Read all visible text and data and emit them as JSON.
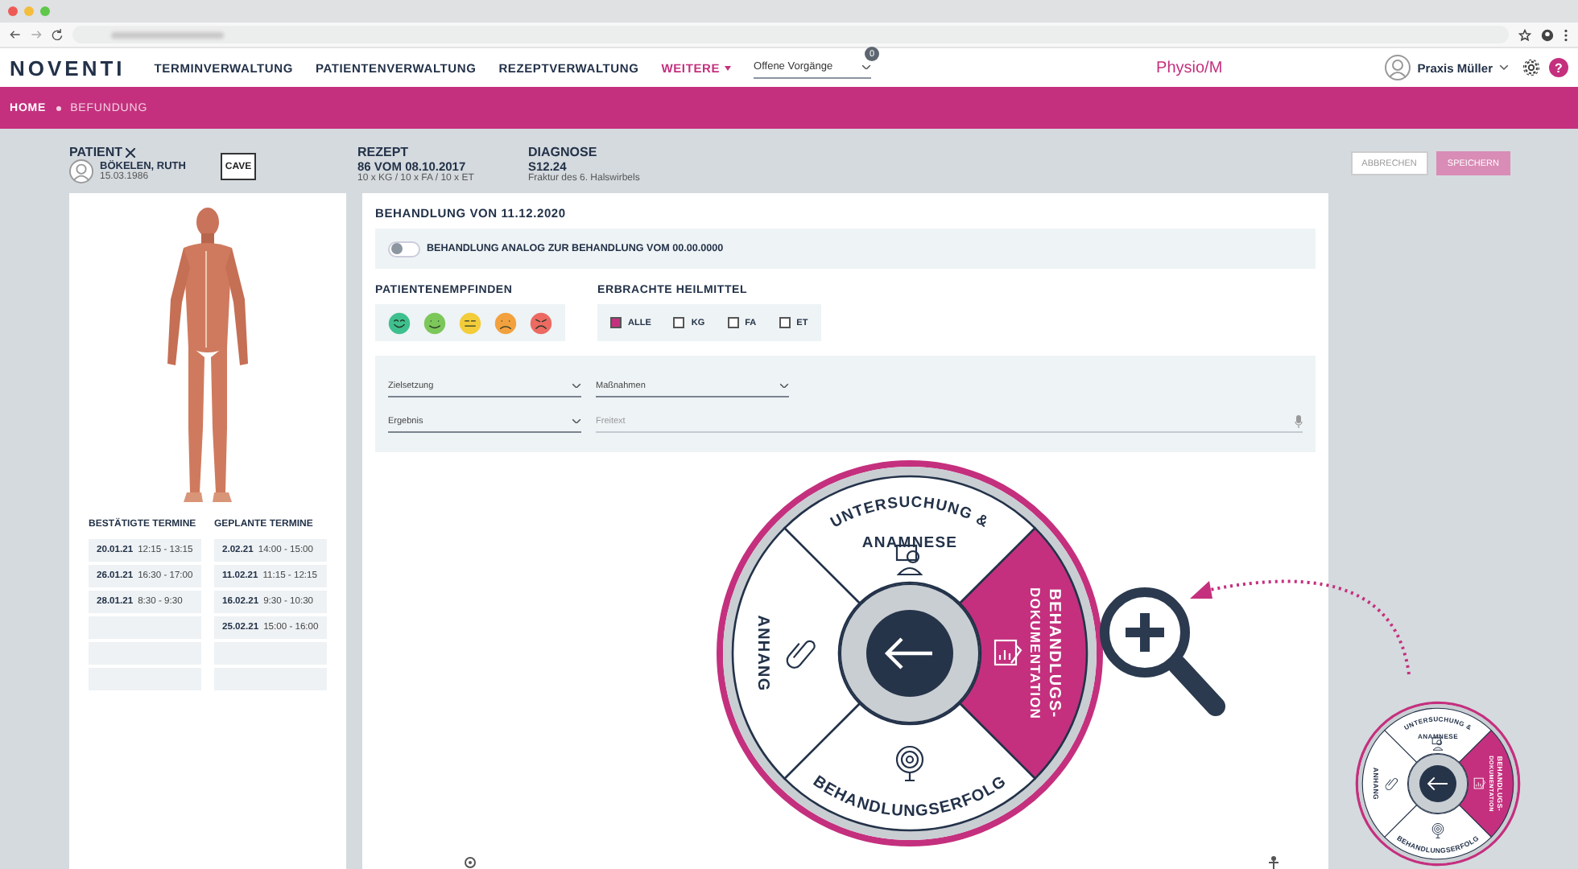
{
  "nav": {
    "logo": "NOVENTI",
    "items": [
      {
        "label": "TERMINVERWALTUNG",
        "selected": false
      },
      {
        "label": "PATIENTENVERWALTUNG",
        "selected": false
      },
      {
        "label": "REZEPTVERWALTUNG",
        "selected": false
      },
      {
        "label": "WEITERE",
        "selected": true
      }
    ],
    "dropdown": {
      "value": "Offene Vorgänge",
      "badge": "0"
    },
    "module": "Physio/M",
    "user": "Praxis Müller",
    "help": "?"
  },
  "breadcrumb": [
    "HOME",
    "BEFUNDUNG"
  ],
  "patient": {
    "heading": "PATIENT",
    "name": "BÖKELEN, RUTH",
    "birthdate": "15.03.1986",
    "cave": "CAVE"
  },
  "rezept": {
    "heading": "REZEPT",
    "title": "86 VOM 08.10.2017",
    "detail": "10 x KG / 10 x FA / 10 x ET"
  },
  "diagnose": {
    "heading": "DIAGNOSE",
    "title": "S12.24",
    "detail": "Fraktur des 6. Halswirbels"
  },
  "actions": [
    {
      "label": "ABBRECHEN",
      "kind": "secondary"
    },
    {
      "label": "SPEICHERN",
      "kind": "primary"
    }
  ],
  "appointments": [
    {
      "heading": "BESTÄTIGTE TERMINE",
      "rows": [
        {
          "kind": "booked",
          "date": "20.01.21",
          "time": "12:15 - 13:15"
        },
        {
          "kind": "booked",
          "date": "26.01.21",
          "time": "16:30 - 17:00"
        },
        {
          "kind": "booked",
          "date": "28.01.21",
          "time": "8:30 - 9:30"
        },
        {
          "kind": "empty"
        },
        {
          "kind": "empty"
        },
        {
          "kind": "empty"
        }
      ]
    },
    {
      "heading": "GEPLANTE TERMINE",
      "rows": [
        {
          "kind": "booked",
          "date": "2.02.21",
          "time": "14:00 - 15:00"
        },
        {
          "kind": "booked",
          "date": "11.02.21",
          "time": "11:15 - 12:15"
        },
        {
          "kind": "booked",
          "date": "16.02.21",
          "time": "9:30 - 10:30"
        },
        {
          "kind": "booked",
          "date": "25.02.21",
          "time": "15:00 - 16:00"
        },
        {
          "kind": "empty"
        },
        {
          "kind": "empty"
        }
      ]
    }
  ],
  "treatment": {
    "title": "BEHANDLUNG VON 11.12.2020",
    "toggle": {
      "label": "BEHANDLUNG ANALOG ZUR BEHANDLUNG VOM 00.00.0000",
      "on": false
    },
    "mood": {
      "heading": "PATIENTENEMPFINDEN",
      "faces": [
        {
          "kind": "very_happy",
          "color": "#3ec08e"
        },
        {
          "kind": "happy",
          "color": "#7cc75a"
        },
        {
          "kind": "neutral",
          "color": "#f3cc3a"
        },
        {
          "kind": "sad",
          "color": "#f2a13e"
        },
        {
          "kind": "very_sad",
          "color": "#ec6a62"
        }
      ]
    },
    "remedies": {
      "heading": "ERBRACHTE HEILMITTEL",
      "options": [
        {
          "label": "ALLE",
          "checked": true
        },
        {
          "label": "KG",
          "checked": false
        },
        {
          "label": "FA",
          "checked": false
        },
        {
          "label": "ET",
          "checked": false
        }
      ]
    },
    "fields": [
      {
        "kind": "select",
        "label": "Zielsetzung"
      },
      {
        "kind": "select",
        "label": "Maßnahmen"
      },
      {
        "kind": "select",
        "label": "Ergebnis"
      },
      {
        "kind": "dictation",
        "placeholder": "Freitext"
      }
    ]
  },
  "wheel": {
    "segments": [
      {
        "kind": "exam",
        "lines": [
          "UNTERSUCHUNG &",
          "ANAMNESE"
        ],
        "selected": false
      },
      {
        "kind": "documentation",
        "lines": [
          "BEHANDLUGS-",
          "DOKUMENTATION"
        ],
        "selected": true
      },
      {
        "kind": "result",
        "lines": [
          "BEHANDLUNGSERFOLG"
        ],
        "selected": false
      },
      {
        "kind": "attachment",
        "lines": [
          "ANHANG"
        ],
        "selected": false
      }
    ]
  },
  "mini_wheel": {
    "segments": [
      {
        "kind": "exam",
        "lines": [
          "UNTERSUCHUNG &",
          "ANAMNESE"
        ],
        "selected": false
      },
      {
        "kind": "documentation",
        "lines": [
          "BEHANDLUGS-",
          "DOKUMENTATION"
        ],
        "selected": true
      },
      {
        "kind": "result",
        "lines": [
          "BEHANDLUNGSERFOLG"
        ],
        "selected": false
      },
      {
        "kind": "attachment",
        "lines": [
          "ANHANG"
        ],
        "selected": false
      }
    ]
  }
}
